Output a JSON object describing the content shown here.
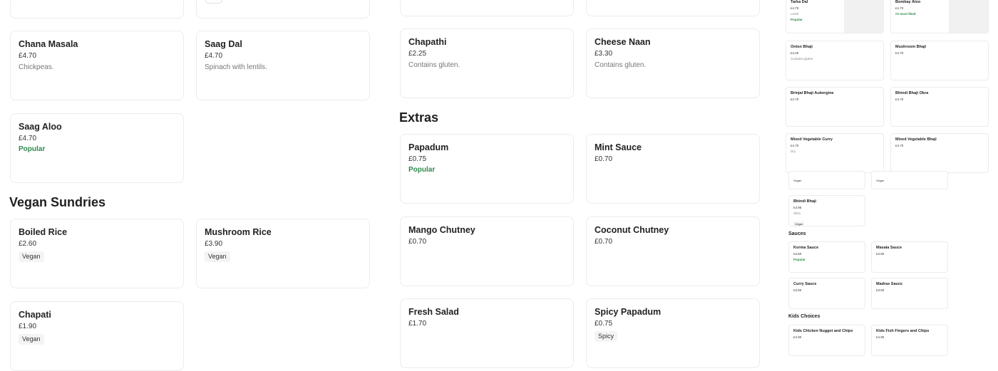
{
  "left_column": {
    "curries": [
      {
        "name": "Chana Masala",
        "price": "£4.70",
        "desc": "Chickpeas."
      },
      {
        "name": "Saag Dal",
        "price": "£4.70",
        "desc": "Spinach with lentils."
      },
      {
        "name": "Saag Aloo",
        "price": "£4.70",
        "badge": "Popular"
      }
    ],
    "vegan_sundries": {
      "heading": "Vegan Sundries",
      "items": [
        {
          "name": "Boiled Rice",
          "price": "£2.60",
          "tag": "Vegan"
        },
        {
          "name": "Mushroom Rice",
          "price": "£3.90",
          "tag": "Vegan"
        },
        {
          "name": "Chapati",
          "price": "£1.90",
          "tag": "Vegan"
        }
      ]
    }
  },
  "middle_column": {
    "breads": [
      {
        "name": "Chapathi",
        "price": "£2.25",
        "desc": "Contains gluten."
      },
      {
        "name": "Cheese Naan",
        "price": "£3.30",
        "desc": "Contains gluten."
      }
    ],
    "extras": {
      "heading": "Extras",
      "items": [
        {
          "name": "Papadum",
          "price": "£0.75",
          "badge": "Popular"
        },
        {
          "name": "Mint Sauce",
          "price": "£0.70"
        },
        {
          "name": "Mango Chutney",
          "price": "£0.70"
        },
        {
          "name": "Coconut Chutney",
          "price": "£0.70"
        },
        {
          "name": "Fresh Salad",
          "price": "£1.70"
        },
        {
          "name": "Spicy Papadum",
          "price": "£0.75",
          "tag": "Spicy"
        }
      ]
    }
  },
  "right_column": {
    "top": [
      {
        "name": "Tarka Dal",
        "price": "£4.70",
        "desc": "Lentil",
        "badge": "Popular"
      },
      {
        "name": "Bombay Aloo",
        "price": "£4.70",
        "liked": "#2 most liked"
      }
    ],
    "bhajis": [
      {
        "name": "Onion Bhaji",
        "price": "£4.20",
        "desc": "Contains gluten."
      },
      {
        "name": "Mushroom Bhaji",
        "price": "£4.70"
      },
      {
        "name": "Brinjal Bhaji Aubergine",
        "price": "£4.70"
      },
      {
        "name": "Bhindi Bhaji Okra",
        "price": "£4.70"
      },
      {
        "name": "Mixed Vegetable Curry",
        "price": "£4.70",
        "desc": "Dry"
      },
      {
        "name": "Mixed Vegetable Bhaji",
        "price": "£4.70"
      }
    ],
    "stub_tags": [
      "Vegan",
      "Vegan"
    ],
    "bhindi": {
      "name": "Bhindi Bhaji",
      "price": "£4.95",
      "desc": "Okra",
      "tag": "Vegan"
    },
    "sauces": {
      "heading": "Sauces",
      "items": [
        {
          "name": "Korma Sauce",
          "price": "£3.60",
          "badge": "Popular"
        },
        {
          "name": "Masala Sauce",
          "price": "£3.60"
        },
        {
          "name": "Curry Sauce",
          "price": "£3.60"
        },
        {
          "name": "Madras Sauce",
          "price": "£3.60"
        }
      ]
    },
    "kids": {
      "heading": "Kids Choices",
      "items": [
        {
          "name": "Kids Chicken Nugget and Chips",
          "price": "£4.90"
        },
        {
          "name": "Kids Fish Fingers and Chips",
          "price": "£4.90"
        }
      ]
    }
  }
}
